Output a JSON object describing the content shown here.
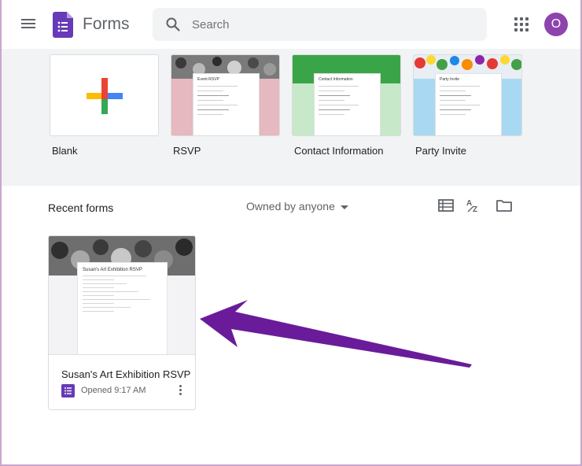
{
  "header": {
    "app_title": "Forms",
    "search_placeholder": "Search",
    "avatar_initial": "O",
    "brand_color": "#673ab7",
    "avatar_color": "#8e44ad"
  },
  "templates": [
    {
      "label": "Blank",
      "icon": "plus-icon"
    },
    {
      "label": "RSVP",
      "thumb_title": "Event RSVP",
      "accent": "#e6b8bf"
    },
    {
      "label": "Contact Information",
      "thumb_title": "Contact Information",
      "accent": "#3aa548"
    },
    {
      "label": "Party Invite",
      "thumb_title": "Party Invite",
      "accent": "#a9d9f2"
    }
  ],
  "recent": {
    "title": "Recent forms",
    "owner_filter": "Owned by anyone",
    "cards": [
      {
        "title": "Susan's Art Exhibition RSVP",
        "meta": "Opened 9:17 AM",
        "thumb_title": "Susan's Art Exhibition RSVP"
      }
    ]
  },
  "icons": [
    "menu-icon",
    "forms-logo-icon",
    "search-icon",
    "apps-grid-icon",
    "list-view-icon",
    "sort-az-icon",
    "folder-icon",
    "more-vert-icon"
  ],
  "annotation_color": "#6a1b9a"
}
